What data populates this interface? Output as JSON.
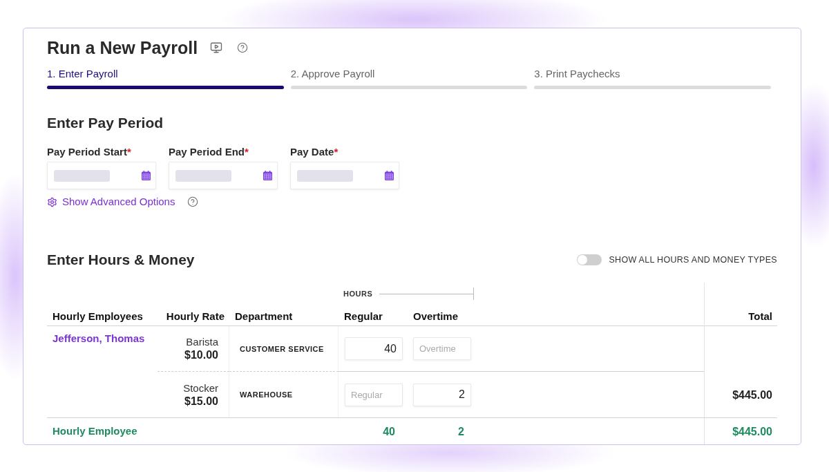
{
  "page": {
    "title": "Run a New Payroll"
  },
  "steps": [
    {
      "label": "1. Enter Payroll",
      "selected": true
    },
    {
      "label": "2. Approve Payroll",
      "selected": false
    },
    {
      "label": "3. Print Paychecks",
      "selected": false
    }
  ],
  "pay_period": {
    "heading": "Enter Pay Period",
    "fields": [
      {
        "label": "Pay Period Start",
        "required_mark": "*",
        "redacted": true
      },
      {
        "label": "Pay Period End",
        "required_mark": "*",
        "redacted": true
      },
      {
        "label": "Pay Date",
        "required_mark": "*",
        "redacted": true
      }
    ],
    "advanced_link": "Show Advanced Options"
  },
  "hours_money": {
    "heading": "Enter Hours & Money",
    "toggle": {
      "label": "SHOW ALL HOURS AND MONEY TYPES",
      "on": false
    },
    "table": {
      "group_heading": "HOURS",
      "columns": [
        "Hourly Employees",
        "Hourly Rate",
        "Department",
        "Regular",
        "Overtime",
        "Total"
      ],
      "employees": [
        {
          "name": "Jefferson, Thomas",
          "jobs": [
            {
              "title": "Barista",
              "rate": "$10.00",
              "department": "CUSTOMER SERVICE",
              "regular": {
                "value": "40"
              },
              "overtime": {
                "placeholder": "Overtime"
              }
            },
            {
              "title": "Stocker",
              "rate": "$15.00",
              "department": "WAREHOUSE",
              "regular": {
                "placeholder": "Regular"
              },
              "overtime": {
                "value": "2"
              }
            }
          ],
          "total": "$445.00"
        }
      ],
      "footer": {
        "label": "Hourly Employee",
        "regular": "40",
        "overtime": "2",
        "total": "$445.00"
      }
    }
  }
}
